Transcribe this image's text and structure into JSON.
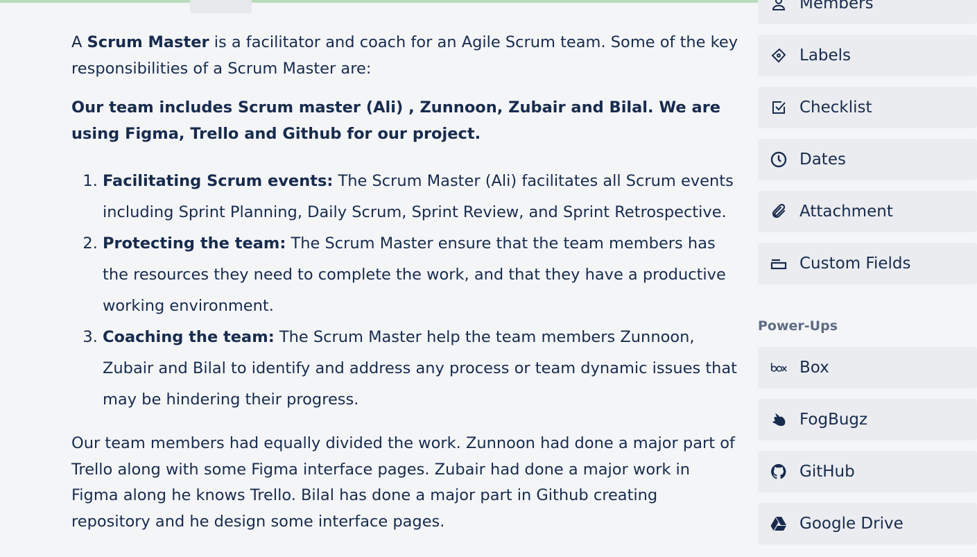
{
  "description": {
    "intro_pre": "A ",
    "intro_bold": "Scrum Master",
    "intro_post": " is a facilitator and coach for an Agile Scrum team. Some of the key responsibilities of a Scrum Master are:",
    "team_note": "Our team includes Scrum master (Ali) , Zunnoon, Zubair and Bilal. We are using Figma, Trello and Github for our project.",
    "items": [
      {
        "title": "Facilitating Scrum events:",
        "text": " The Scrum Master (Ali) facilitates all Scrum events including Sprint Planning, Daily Scrum, Sprint Review, and Sprint Retrospective."
      },
      {
        "title": "Protecting the team:",
        "text": " The Scrum Master ensure that the team members has the resources they need to complete the work, and that they have a productive working environment."
      },
      {
        "title": "Coaching the team:",
        "text": " The Scrum Master help the team members Zunnoon, Zubair and Bilal to identify and address any process or team dynamic issues that may be hindering their progress."
      }
    ],
    "summary": "Our team members had equally divided the work. Zunnoon had done a major part of Trello along with some Figma interface pages. Zubair had done a major work in Figma along he knows Trello. Bilal has done a major part in Github creating repository and he design some interface pages."
  },
  "sidebar": {
    "add_to_card": [
      {
        "label": "Members",
        "icon": "person-icon"
      },
      {
        "label": "Labels",
        "icon": "tag-icon"
      },
      {
        "label": "Checklist",
        "icon": "checkbox-icon"
      },
      {
        "label": "Dates",
        "icon": "clock-icon"
      },
      {
        "label": "Attachment",
        "icon": "paperclip-icon"
      },
      {
        "label": "Custom Fields",
        "icon": "card-field-icon"
      }
    ],
    "powerups_title": "Power-Ups",
    "powerups": [
      {
        "label": "Box",
        "icon": "box-logo-icon"
      },
      {
        "label": "FogBugz",
        "icon": "fogbugz-logo-icon"
      },
      {
        "label": "GitHub",
        "icon": "github-logo-icon"
      },
      {
        "label": "Google Drive",
        "icon": "google-drive-logo-icon"
      }
    ]
  },
  "colors": {
    "text": "#172b4d",
    "muted": "#5e6c84",
    "button_bg": "#ebecf0",
    "page_bg": "#f4f5f7"
  }
}
